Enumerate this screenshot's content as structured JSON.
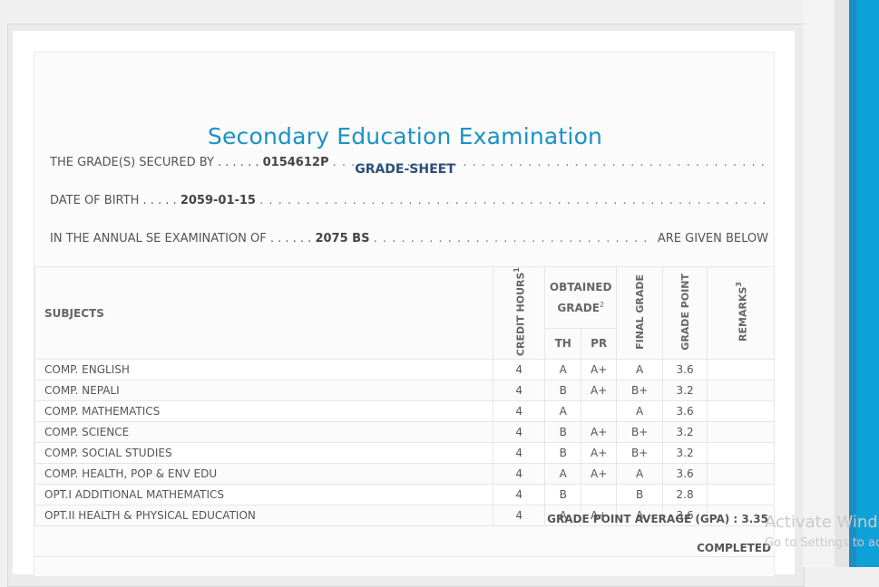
{
  "header": {
    "title": "Secondary Education Examination",
    "subtitle": "GRADE-SHEET"
  },
  "details": {
    "secured_by_label": "THE GRADE(S) SECURED BY . . . . . .",
    "secured_by_value": "0154612P",
    "dob_label": "DATE OF BIRTH . . . . .",
    "dob_value": "2059-01-15",
    "exam_label": "IN THE ANNUAL SE EXAMINATION OF . . . . . .",
    "exam_value": "2075 BS",
    "exam_suffix": "ARE GIVEN BELOW"
  },
  "table": {
    "headers": {
      "subjects": "SUBJECTS",
      "credit_hours": "CREDIT HOURS",
      "credit_sup": "1",
      "obtained_grade": "OBTAINED GRADE",
      "obtained_sup": "2",
      "th": "TH",
      "pr": "PR",
      "final_grade": "FINAL GRADE",
      "grade_point": "GRADE POINT",
      "remarks": "REMARKS",
      "remarks_sup": "3"
    },
    "rows": [
      {
        "subject": "COMP. ENGLISH",
        "credit": "4",
        "th": "A",
        "pr": "A+",
        "final": "A",
        "gp": "3.6",
        "remarks": ""
      },
      {
        "subject": "COMP. NEPALI",
        "credit": "4",
        "th": "B",
        "pr": "A+",
        "final": "B+",
        "gp": "3.2",
        "remarks": ""
      },
      {
        "subject": "COMP. MATHEMATICS",
        "credit": "4",
        "th": "A",
        "pr": "",
        "final": "A",
        "gp": "3.6",
        "remarks": ""
      },
      {
        "subject": "COMP. SCIENCE",
        "credit": "4",
        "th": "B",
        "pr": "A+",
        "final": "B+",
        "gp": "3.2",
        "remarks": ""
      },
      {
        "subject": "COMP. SOCIAL STUDIES",
        "credit": "4",
        "th": "B",
        "pr": "A+",
        "final": "B+",
        "gp": "3.2",
        "remarks": ""
      },
      {
        "subject": "COMP. HEALTH, POP & ENV EDU",
        "credit": "4",
        "th": "A",
        "pr": "A+",
        "final": "A",
        "gp": "3.6",
        "remarks": ""
      },
      {
        "subject": "OPT.I ADDITIONAL MATHEMATICS",
        "credit": "4",
        "th": "B",
        "pr": "",
        "final": "B",
        "gp": "2.8",
        "remarks": ""
      },
      {
        "subject": "OPT.II HEALTH & PHYSICAL EDUCATION",
        "credit": "4",
        "th": "A",
        "pr": "A+",
        "final": "A",
        "gp": "3.6",
        "remarks": ""
      }
    ]
  },
  "summary": {
    "gpa_label": "GRADE POINT AVERAGE (GPA) :",
    "gpa_value": "3.35",
    "status": "COMPLETED"
  },
  "watermark": {
    "line1": "Activate Windows",
    "line2": "Go to Settings to activate Windows."
  },
  "colors": {
    "title": "#1a92c6",
    "subtitle": "#2a4f7a",
    "accent_strip": "#1a8fc4"
  }
}
